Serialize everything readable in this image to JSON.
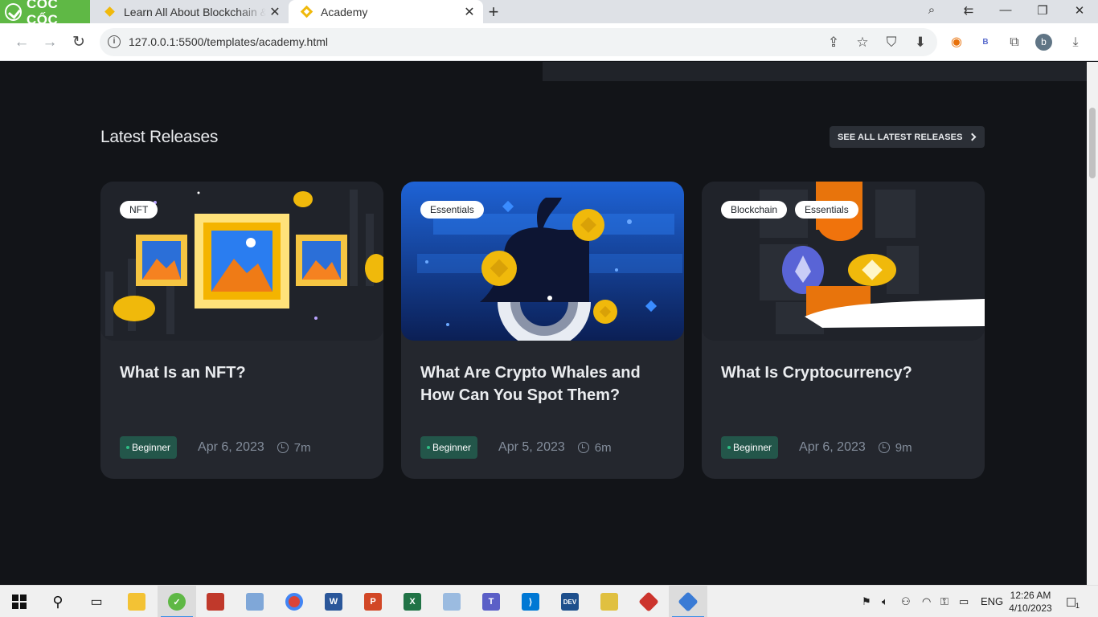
{
  "browser": {
    "brand": "CỐC CỐC",
    "tabs": [
      {
        "title": "Learn All About Blockchain & Crypto",
        "active": false
      },
      {
        "title": "Academy",
        "active": true
      }
    ],
    "url": "127.0.0.1:5500/templates/academy.html",
    "profile_initial": "b",
    "ext_letter": "B"
  },
  "section": {
    "title": "Latest Releases",
    "see_all": "SEE ALL LATEST RELEASES"
  },
  "cards": [
    {
      "tags": [
        "NFT"
      ],
      "title": "What Is an NFT?",
      "level": "Beginner",
      "date": "Apr 6, 2023",
      "duration": "7m"
    },
    {
      "tags": [
        "Essentials"
      ],
      "title": "What Are Crypto Whales and How Can You Spot Them?",
      "level": "Beginner",
      "date": "Apr 5, 2023",
      "duration": "6m"
    },
    {
      "tags": [
        "Blockchain",
        "Essentials"
      ],
      "title": "What Is Cryptocurrency?",
      "level": "Beginner",
      "date": "Apr 6, 2023",
      "duration": "9m"
    }
  ],
  "taskbar": {
    "lang": "ENG",
    "time": "12:26 AM",
    "date": "4/10/2023",
    "notifications": "1"
  },
  "colors": {
    "page_bg": "#121418",
    "card_bg": "#24272e",
    "accent": "#f0b90b",
    "level_bg": "#23564a"
  }
}
